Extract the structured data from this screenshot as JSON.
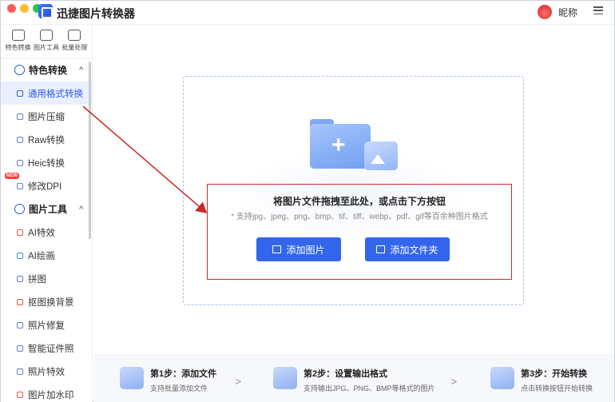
{
  "app": {
    "title": "迅捷图片转换器"
  },
  "user": {
    "name": "昵称"
  },
  "top_tools": [
    {
      "label": "特色转换",
      "icon": "convert-icon"
    },
    {
      "label": "图片工具",
      "icon": "image-tool-icon"
    },
    {
      "label": "批量处理",
      "icon": "batch-icon"
    }
  ],
  "sidebar": {
    "group1": {
      "label": "特色转换"
    },
    "group1_items": [
      {
        "label": "通用格式转换",
        "active": true
      },
      {
        "label": "图片压缩"
      },
      {
        "label": "Raw转换"
      },
      {
        "label": "Heic转换"
      },
      {
        "label": "修改DPI",
        "badge": "NEW"
      }
    ],
    "group2": {
      "label": "图片工具"
    },
    "group2_items": [
      {
        "label": "AI特效"
      },
      {
        "label": "AI绘画"
      },
      {
        "label": "拼图"
      },
      {
        "label": "抠图换背景"
      },
      {
        "label": "照片修复"
      },
      {
        "label": "智能证件照"
      },
      {
        "label": "照片特效"
      },
      {
        "label": "图片加水印"
      }
    ]
  },
  "dropzone": {
    "title": "将图片文件拖拽至此处，或点击下方按钮",
    "subtitle": "* 支持jpg、jpeg、png、bmp、tif、tiff、webp、pdf、gif等百余种图片格式",
    "add_image": "添加图片",
    "add_folder": "添加文件夹"
  },
  "steps": [
    {
      "title": "第1步：添加文件",
      "desc": "支持批量添加文件"
    },
    {
      "title": "第2步：设置输出格式",
      "desc": "支持输出JPG、PNG、BMP等格式的图片"
    },
    {
      "title": "第3步：开始转换",
      "desc": "点击转换按钮开始转换"
    }
  ],
  "annotation_color": "#c62a2a",
  "accent": "#3466eb"
}
